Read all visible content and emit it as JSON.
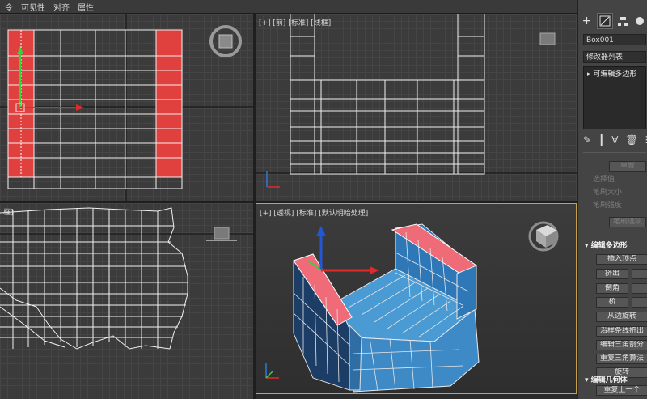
{
  "menu": {
    "items": [
      "令",
      "可见性",
      "对齐",
      "属性"
    ]
  },
  "viewports": {
    "top_left": {
      "label": ""
    },
    "top_right": {
      "label": "[+] [前] [标准] [线框]"
    },
    "bottom_left": {
      "label": "框]"
    },
    "bottom_right": {
      "label": "[+] [透视] [标准] [默认明暗处理]"
    }
  },
  "panel": {
    "tabs": [
      {
        "icon": "plus-icon"
      },
      {
        "icon": "modify-icon"
      },
      {
        "icon": "hierarchy-icon"
      },
      {
        "icon": "motion-icon"
      }
    ],
    "object_name": "Box001",
    "modifier_list": "修改器列表",
    "stack_item": "可编辑多边形",
    "stack_item_arrow": "▸",
    "dim_button": "重置",
    "selection_labels": [
      "选择值",
      "笔刷大小",
      "笔刷强度"
    ],
    "selection_button": "笔刷选项",
    "section_title": "编辑多边形",
    "buttons": {
      "insert_vertex": "插入顶点",
      "extrude": "挤出",
      "bevel": "倒角",
      "bridge": "桥",
      "hinge_from_edge": "从边旋转",
      "extrude_along_spline": "沿样条线挤出",
      "edit_triangulation": "编辑三角剖分",
      "retriangulate": "重复三角算法",
      "rotate": "旋转"
    },
    "geometry_title": "编辑几何体",
    "repeat_last": "重复上一个"
  },
  "colors": {
    "accent_red": "#e0413e",
    "selected_face_pink": "#ef6b78",
    "poly_blue": "#3d8ac7",
    "viewport_border_active": "#c8a34a"
  }
}
